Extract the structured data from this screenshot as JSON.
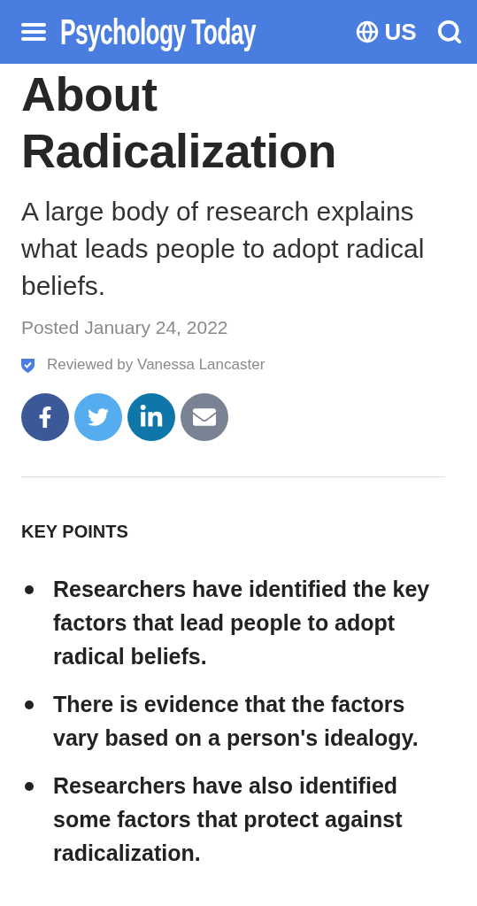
{
  "header": {
    "logo": "Psychology Today",
    "region": "US"
  },
  "article": {
    "title": "About Radicalization",
    "subtitle": "A large body of research explains what leads people to adopt radical beliefs.",
    "posted": "Posted January 24, 2022",
    "reviewed": "Reviewed by Vanessa Lancaster"
  },
  "share": [
    {
      "kind": "facebook",
      "color": "#3b5998"
    },
    {
      "kind": "twitter",
      "color": "#55acee"
    },
    {
      "kind": "linkedin",
      "color": "#0e76a8"
    },
    {
      "kind": "email",
      "color": "#7a8394"
    }
  ],
  "key_points": {
    "heading": "KEY POINTS",
    "items": [
      "Researchers have identified the key factors that lead people to adopt radical beliefs.",
      "There is evidence that the factors vary based on a person's idealogy.",
      "Researchers have also identified some factors that protect against radicalization."
    ]
  }
}
